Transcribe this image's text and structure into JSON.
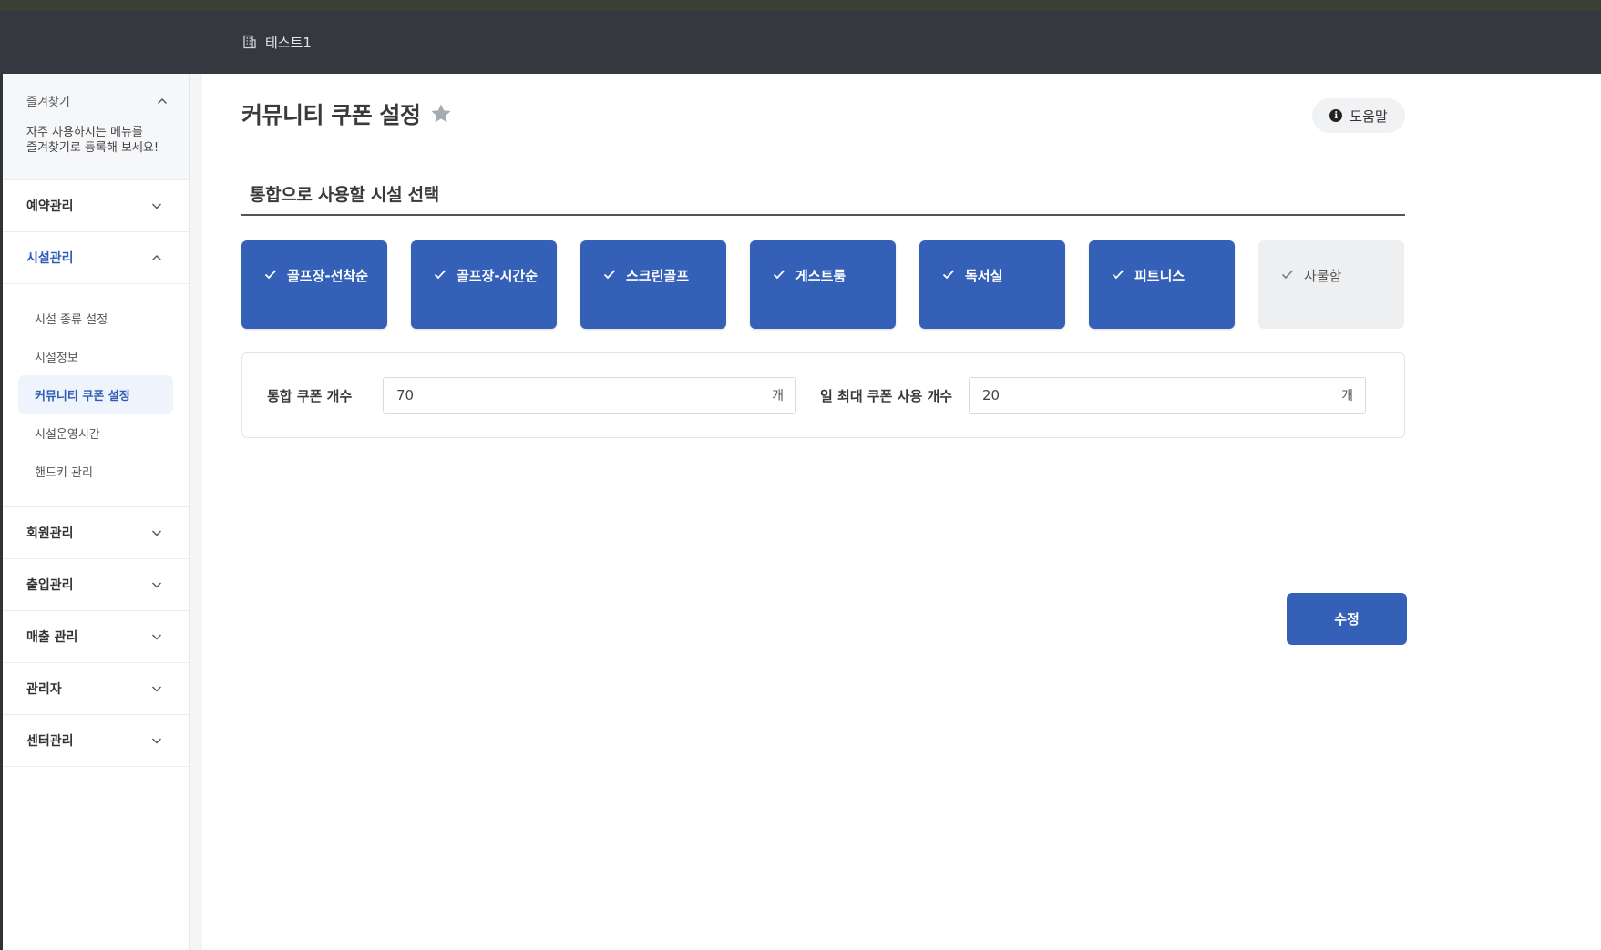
{
  "header": {
    "site_name": "테스트1"
  },
  "sidebar": {
    "favorites": {
      "title": "즐겨찾기",
      "hint": "자주 사용하시는 메뉴를\n즐겨찾기로 등록해 보세요!"
    },
    "menus": [
      {
        "label": "예약관리"
      },
      {
        "label": "시설관리"
      },
      {
        "label": "회원관리"
      },
      {
        "label": "출입관리"
      },
      {
        "label": "매출 관리"
      },
      {
        "label": "관리자"
      },
      {
        "label": "센터관리"
      }
    ],
    "facility_submenu": [
      {
        "label": "시설 종류 설정"
      },
      {
        "label": "시설정보"
      },
      {
        "label": "커뮤니티 쿠폰 설정"
      },
      {
        "label": "시설운영시간"
      },
      {
        "label": "핸드키 관리"
      }
    ]
  },
  "page": {
    "title": "커뮤니티 쿠폰 설정",
    "help_label": "도움말",
    "section_title": "통합으로 사용할 시설 선택",
    "facilities": [
      {
        "label": "골프장-선착순",
        "selected": true
      },
      {
        "label": "골프장-시간순",
        "selected": true
      },
      {
        "label": "스크린골프",
        "selected": true
      },
      {
        "label": "게스트룸",
        "selected": true
      },
      {
        "label": "독서실",
        "selected": true
      },
      {
        "label": "피트니스",
        "selected": true
      },
      {
        "label": "사물함",
        "selected": false
      }
    ],
    "coupon": {
      "total_label": "통합 쿠폰 개수",
      "total_value": "70",
      "daily_label": "일 최대 쿠폰 사용 개수",
      "daily_value": "20",
      "unit": "개"
    },
    "submit_label": "수정"
  },
  "colors": {
    "primary": "#3460b8",
    "topbar": "#35383e",
    "unselected": "#eeeff1"
  }
}
